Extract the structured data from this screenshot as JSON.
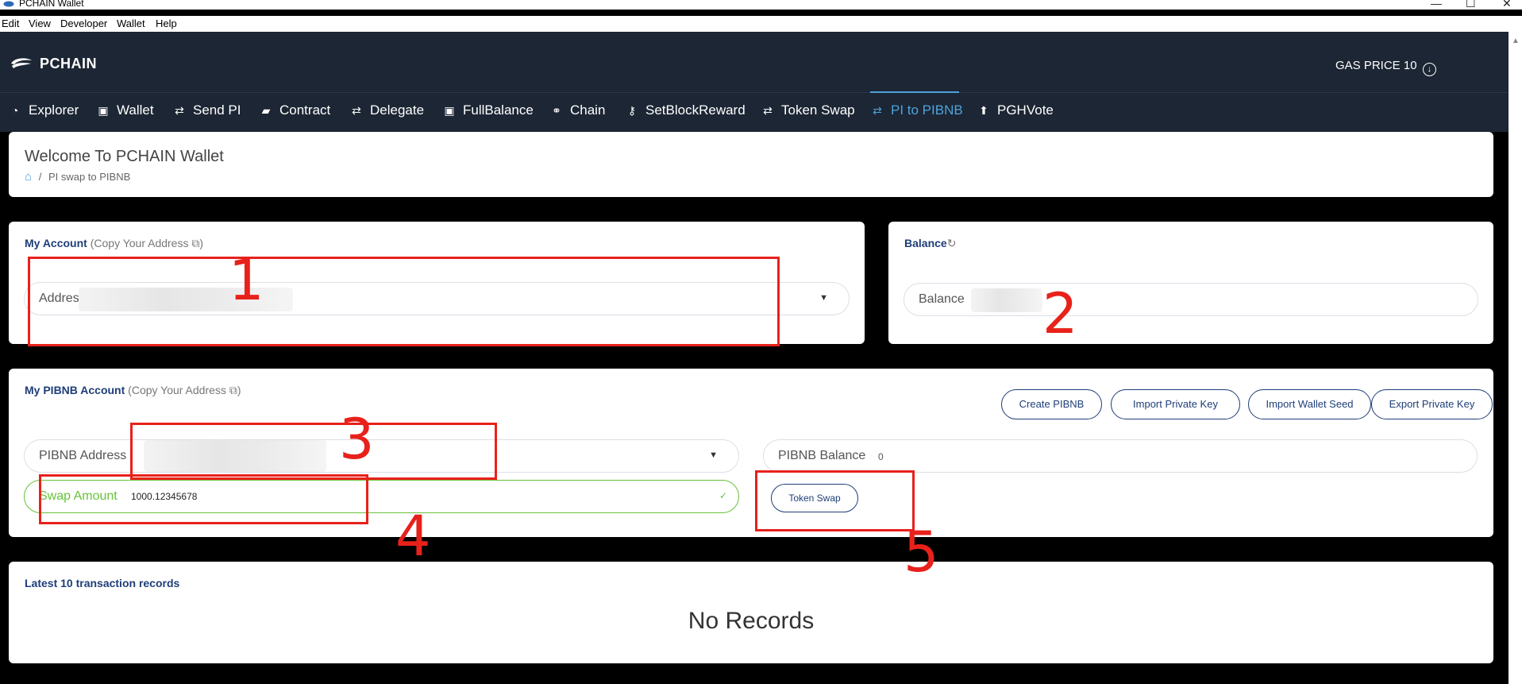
{
  "window": {
    "title": "PCHAIN Wallet",
    "minimize": "—",
    "maximize": "☐",
    "close": "✕"
  },
  "menu": {
    "items": [
      "Edit",
      "View",
      "Developer",
      "Wallet",
      "Help"
    ]
  },
  "header": {
    "brand": "PCHAIN",
    "gas_label": "GAS PRICE 10",
    "gas_icon": "arrow-down-circle-icon"
  },
  "nav": {
    "items": [
      {
        "label": "Explorer",
        "icon": "gauge-icon",
        "glyph": "◔"
      },
      {
        "label": "Wallet",
        "icon": "briefcase-icon",
        "glyph": "▣"
      },
      {
        "label": "Send PI",
        "icon": "swap-icon",
        "glyph": "⇄"
      },
      {
        "label": "Contract",
        "icon": "book-icon",
        "glyph": "▰"
      },
      {
        "label": "Delegate",
        "icon": "swap-icon",
        "glyph": "⇄"
      },
      {
        "label": "FullBalance",
        "icon": "briefcase-icon",
        "glyph": "▣"
      },
      {
        "label": "Chain",
        "icon": "link-icon",
        "glyph": "⚭"
      },
      {
        "label": "SetBlockReward",
        "icon": "key-icon",
        "glyph": "⚷"
      },
      {
        "label": "Token Swap",
        "icon": "swap-icon",
        "glyph": "⇄"
      },
      {
        "label": "PI to PIBNB",
        "icon": "swap-icon",
        "glyph": "⇄",
        "active": true
      },
      {
        "label": "PGHVote",
        "icon": "upload-circle-icon",
        "glyph": "⬆"
      }
    ]
  },
  "welcome": {
    "title": "Welcome To PCHAIN Wallet",
    "breadcrumb_sep": "/",
    "breadcrumb_current": "PI swap to PIBNB"
  },
  "my_account": {
    "title": "My Account",
    "subtitle": "(Copy Your Address",
    "subtitle_end": ")",
    "address_label": "Addres"
  },
  "balance": {
    "title": "Balance",
    "field_label": "Balance"
  },
  "pibnb": {
    "title": "My PIBNB Account",
    "subtitle": "(Copy Your Address",
    "subtitle_end": ")",
    "buttons": {
      "create": "Create PIBNB",
      "import_key": "Import Private Key",
      "import_seed": "Import Wallet Seed",
      "export_key": "Export Private Key"
    },
    "address_label": "PIBNB Address",
    "balance_label": "PIBNB Balance",
    "balance_value": "0",
    "swap_label": "Swap Amount",
    "swap_value": "1000.12345678",
    "swap_button": "Token Swap"
  },
  "records": {
    "title": "Latest 10 transaction records",
    "empty": "No Records"
  },
  "annotations": {
    "n1": "1",
    "n2": "2",
    "n3": "3",
    "n4": "4",
    "n5": "5",
    "color": "#e8211b"
  }
}
